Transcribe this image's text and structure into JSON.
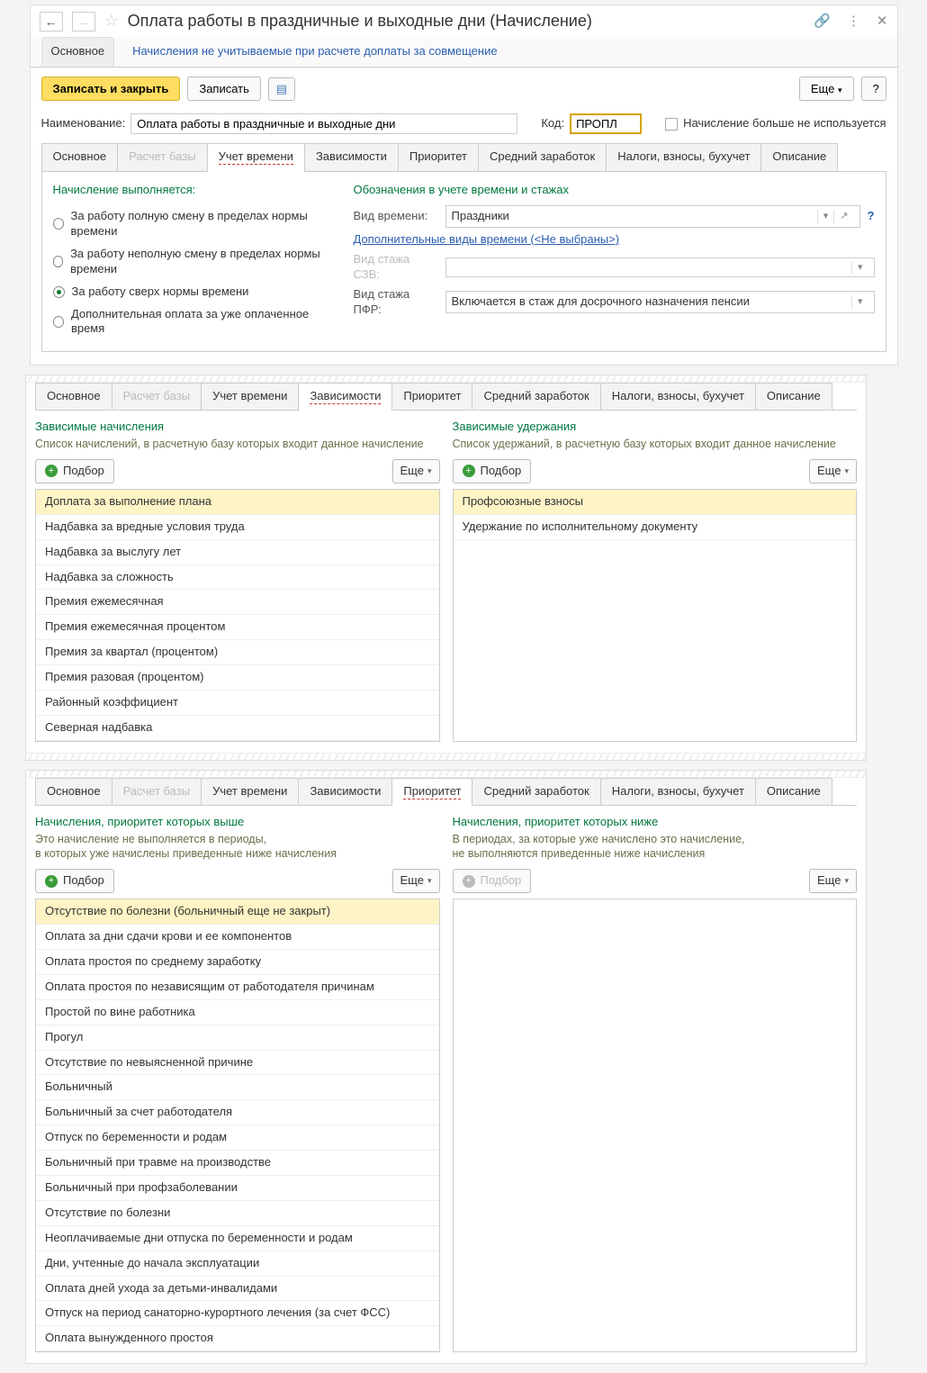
{
  "header": {
    "title": "Оплата работы в праздничные и выходные дни (Начисление)",
    "main_tabs": {
      "active": "Основное",
      "other": "Начисления не учитываемые при расчете доплаты за совмещение"
    }
  },
  "toolbar": {
    "save_close": "Записать и закрыть",
    "save": "Записать",
    "more": "Еще",
    "help": "?"
  },
  "fields": {
    "name_label": "Наименование:",
    "name_value": "Оплата работы в праздничные и выходные дни",
    "code_label": "Код:",
    "code_value": "ПРОПЛ",
    "unused_label": "Начисление больше не используется"
  },
  "tabs": [
    "Основное",
    "Расчет базы",
    "Учет времени",
    "Зависимости",
    "Приоритет",
    "Средний заработок",
    "Налоги, взносы, бухучет",
    "Описание"
  ],
  "time_tab": {
    "left_h": "Начисление выполняется:",
    "radios": [
      "За работу полную смену в пределах нормы времени",
      "За работу неполную смену в пределах нормы времени",
      "За работу сверх нормы времени",
      "Дополнительная оплата за уже оплаченное время"
    ],
    "radio_selected": 2,
    "right_h": "Обозначения в учете времени и стажах",
    "vid_vremeni_label": "Вид времени:",
    "vid_vremeni_value": "Праздники",
    "extra_link": "Дополнительные виды времени (<Не выбраны>)",
    "szv_label": "Вид стажа СЗВ:",
    "szv_value": "",
    "pfr_label": "Вид стажа ПФР:",
    "pfr_value": "Включается в стаж для досрочного назначения пенсии"
  },
  "dep_tab": {
    "left_h": "Зависимые начисления",
    "left_sub": "Список начислений, в расчетную базу которых входит данное начисление",
    "right_h": "Зависимые удержания",
    "right_sub": "Список удержаний, в расчетную базу которых входит данное начисление",
    "podbor": "Подбор",
    "more": "Еще",
    "left_rows": [
      "Доплата за выполнение плана",
      "Надбавка за вредные условия труда",
      "Надбавка за выслугу лет",
      "Надбавка за сложность",
      "Премия ежемесячная",
      "Премия ежемесячная процентом",
      "Премия за квартал (процентом)",
      "Премия разовая (процентом)",
      "Районный коэффициент",
      "Северная надбавка"
    ],
    "right_rows": [
      "Профсоюзные взносы",
      "Удержание по исполнительному документу"
    ]
  },
  "prio_tab": {
    "left_h": "Начисления, приоритет которых выше",
    "left_sub": "Это начисление не выполняется в периоды,\nв которых уже начислены приведенные ниже начисления",
    "right_h": "Начисления, приоритет которых ниже",
    "right_sub": "В периодах, за которые уже начислено это начисление,\nне выполняются приведенные ниже начисления",
    "left_rows": [
      "Отсутствие по болезни (больничный еще не закрыт)",
      "Оплата за дни сдачи крови и ее компонентов",
      "Оплата простоя по среднему заработку",
      "Оплата простоя по независящим от работодателя причинам",
      "Простой по вине работника",
      "Прогул",
      "Отсутствие по невыясненной причине",
      "Больничный",
      "Больничный за счет работодателя",
      "Отпуск по беременности и родам",
      "Больничный при травме на производстве",
      "Больничный при профзаболевании",
      "Отсутствие по болезни",
      "Неоплачиваемые дни отпуска по беременности и родам",
      "Дни, учтенные до начала эксплуатации",
      "Оплата дней ухода за детьми-инвалидами",
      "Отпуск на период санаторно-курортного лечения (за счет ФСС)",
      "Оплата вынужденного простоя"
    ],
    "right_rows": []
  }
}
